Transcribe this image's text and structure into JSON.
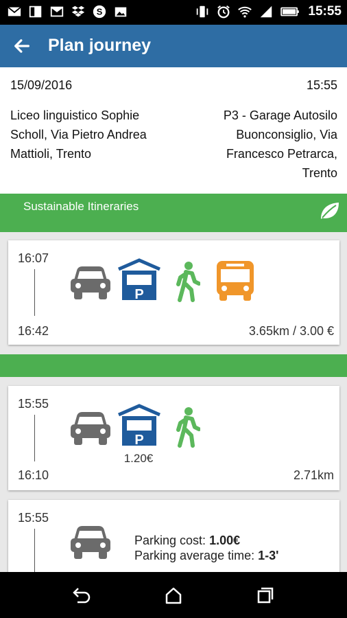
{
  "status_bar": {
    "time": "15:55",
    "left_icons": [
      "mail-icon",
      "notes-icon",
      "gmail-icon",
      "dropbox-icon",
      "skype-icon",
      "image-icon"
    ],
    "right_icons": [
      "vibrate-icon",
      "alarm-icon",
      "wifi-icon",
      "signal-icon",
      "battery-icon"
    ]
  },
  "app_bar": {
    "title": "Plan journey",
    "back_icon": "arrow-left-icon"
  },
  "journey": {
    "date": "15/09/2016",
    "time": "15:55",
    "from": "Liceo linguistico Sophie Scholl, Via Pietro Andrea Mattioli, Trento",
    "to": "P3 - Garage Autosilo Buonconsiglio, Via Francesco Petrarca, Trento"
  },
  "sustainable_banner": {
    "label": "Sustainable Itineraries",
    "icon": "leaf-icon"
  },
  "colors": {
    "app_bar": "#2e6da4",
    "banner_green": "#4caf50",
    "car_gray": "#6b6b6b",
    "parking_blue": "#1f5b9c",
    "walk_green": "#5cb85c",
    "bus_orange": "#f0962a"
  },
  "itineraries": [
    {
      "start": "16:07",
      "end": "16:42",
      "summary": "3.65km / 3.00 €",
      "modes": [
        "car-icon",
        "parking-icon",
        "walk-icon",
        "bus-icon"
      ]
    },
    {
      "start": "15:55",
      "end": "16:10",
      "summary": "2.71km",
      "parking_cost": "1.20€",
      "modes": [
        "car-icon",
        "parking-icon",
        "walk-icon"
      ]
    },
    {
      "start": "15:55",
      "modes": [
        "car-icon"
      ],
      "parking_cost_label": "Parking cost:",
      "parking_cost_value": "1.00€",
      "parking_time_label": "Parking average time:",
      "parking_time_value": "1-3'"
    }
  ],
  "nav_bar": [
    "back-nav-icon",
    "home-nav-icon",
    "recents-nav-icon"
  ]
}
